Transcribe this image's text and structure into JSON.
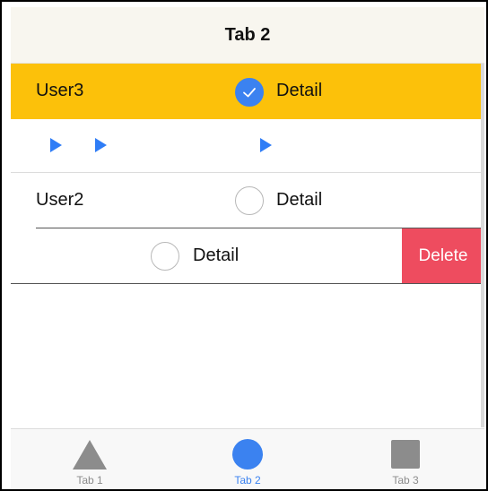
{
  "header": {
    "title": "Tab 2"
  },
  "list": {
    "rows": [
      {
        "user": "User3",
        "detail": "Detail",
        "checked": true
      },
      {
        "user": "",
        "detail": "",
        "icons": [
          "play-icon",
          "play-icon",
          "play-icon"
        ]
      },
      {
        "user": "User2",
        "detail": "Detail",
        "checked": false
      },
      {
        "user": "",
        "detail": "Detail",
        "checked": false,
        "swipe_action": "Delete"
      }
    ]
  },
  "tabbar": {
    "tabs": [
      {
        "label": "Tab 1",
        "icon": "triangle-icon",
        "active": false
      },
      {
        "label": "Tab 2",
        "icon": "circle-icon",
        "active": true
      },
      {
        "label": "Tab 3",
        "icon": "square-icon",
        "active": false
      }
    ]
  },
  "colors": {
    "selected_row": "#fcc10a",
    "accent": "#3b82f0",
    "delete": "#ee4c5f",
    "inactive_icon": "#8c8c8c"
  }
}
